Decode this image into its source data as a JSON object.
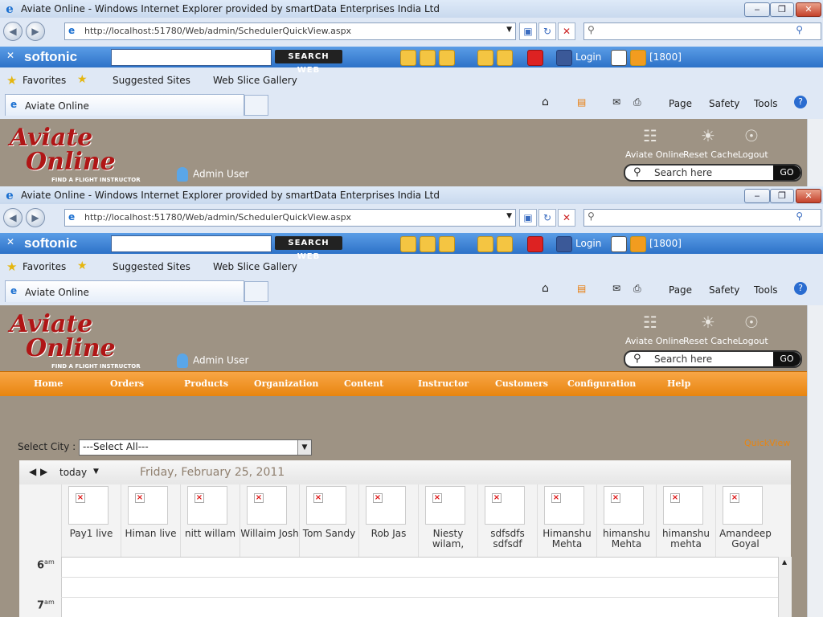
{
  "window": {
    "title": "Aviate Online - Windows Internet Explorer provided by smartData Enterprises India Ltd",
    "url": "http://localhost:51780/Web/admin/SchedulerQuickView.aspx",
    "buttons": {
      "minimize": "‒",
      "maximize": "❐",
      "close": "✕"
    }
  },
  "softonic": {
    "logo": "softonic",
    "search_button": "SEARCH WEB",
    "login": "Login",
    "count": "[1800]"
  },
  "favorites": {
    "favorites": "Favorites",
    "suggested": "Suggested Sites",
    "webslice": "Web Slice Gallery"
  },
  "tab": {
    "label": "Aviate Online"
  },
  "commands": {
    "page": "Page",
    "safety": "Safety",
    "tools": "Tools"
  },
  "site": {
    "logo_line1": "Aviate",
    "logo_line2": "Online",
    "tagline": "FIND A FLIGHT INSTRUCTOR",
    "admin_user": "Admin User",
    "links": {
      "aviate": "Aviate Online",
      "reset": "Reset Cache",
      "logout": "Logout"
    },
    "search_placeholder": "Search here",
    "go": "GO"
  },
  "menu": [
    "Home",
    "Orders",
    "Products",
    "Organization",
    "Content",
    "Instructor",
    "Customers",
    "Configuration",
    "Help"
  ],
  "filter": {
    "select_city_label": "Select City :",
    "select_city_value": "---Select All---",
    "quickview": "QuickView"
  },
  "scheduler": {
    "today": "today",
    "date": "Friday, February 25, 2011",
    "resources": [
      "Pay1 live",
      "Himan live",
      "nitt willam",
      "Willaim Josh",
      "Tom Sandy",
      "Rob Jas",
      "Niesty wilam,",
      "sdfsdfs sdfsdf",
      "Himanshu Mehta",
      "himanshu Mehta",
      "himanshu mehta",
      "Amandeep Goyal"
    ],
    "times": [
      "6",
      "7"
    ],
    "ampm": "am"
  }
}
